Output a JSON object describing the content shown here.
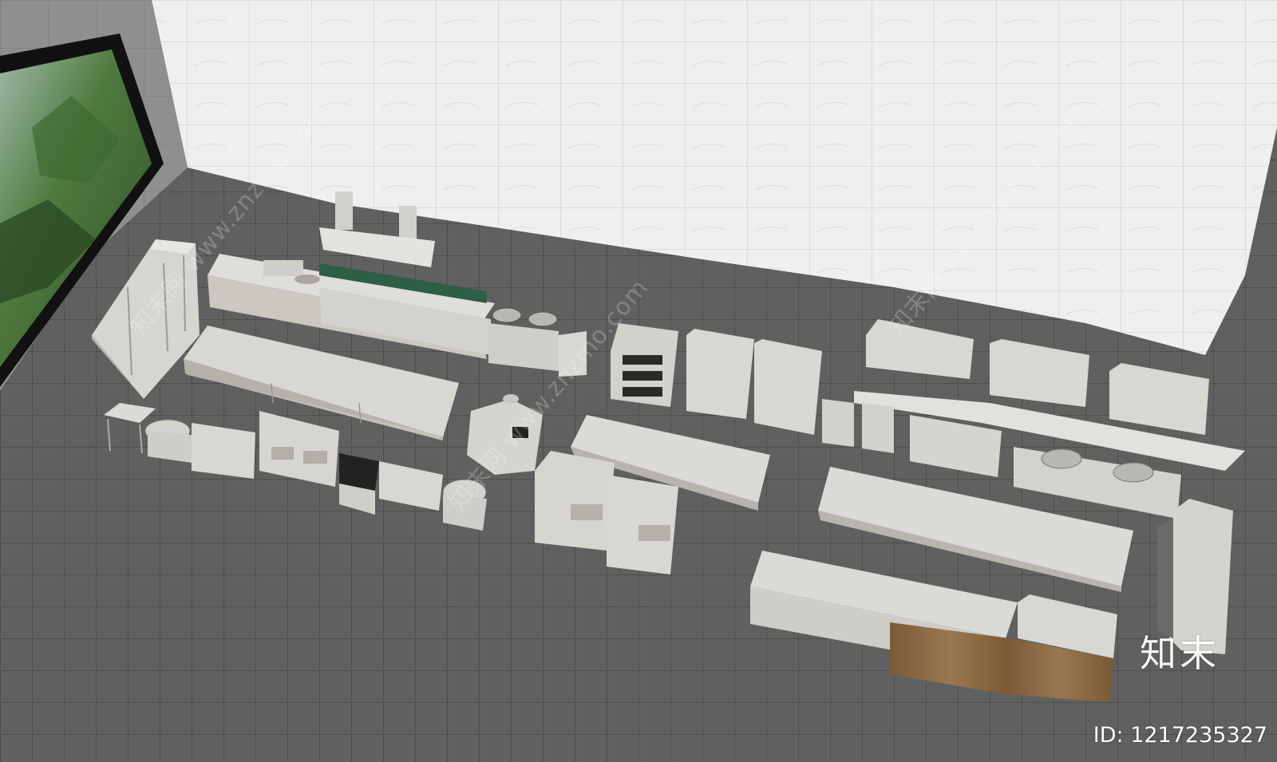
{
  "brand": {
    "logo_text": "知末",
    "id_label": "ID: 1217235327"
  },
  "watermark": {
    "text": "知末网 www.znzmo.com"
  },
  "colors": {
    "floor": "#5f5f5f",
    "floor_grid": "#4a4a4a",
    "wall_tile": "#eeeeee",
    "steel": "#d9d7d2",
    "steel_shadow": "#bdbab4",
    "wood": "#8a6a45"
  }
}
